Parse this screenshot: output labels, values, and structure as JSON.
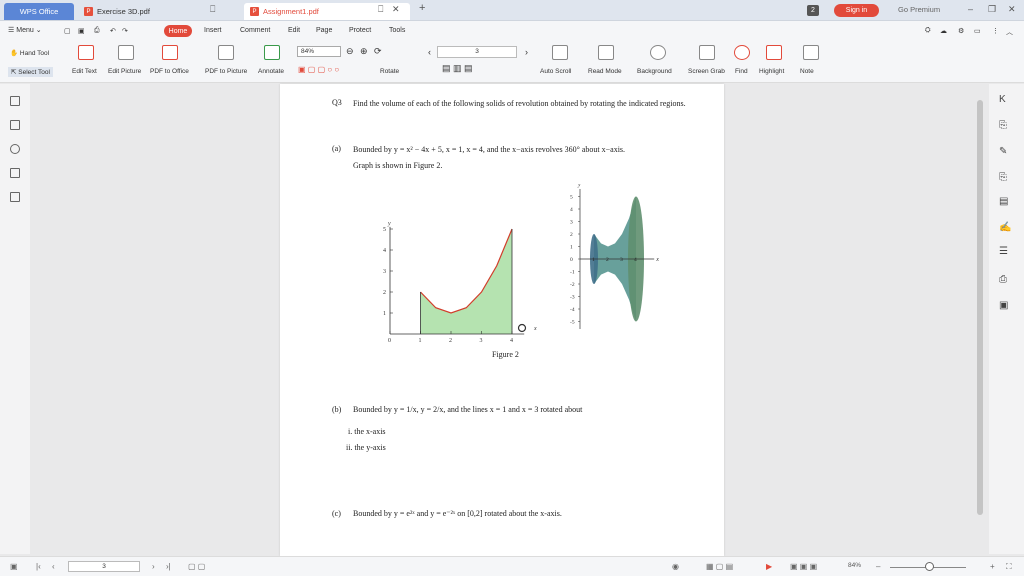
{
  "tabs": {
    "brand": "WPS Office",
    "doc1": "Exercise 3D.pdf",
    "doc2": "Assignment1.pdf",
    "new_tab": "+"
  },
  "header_right": {
    "badge": "2",
    "sign_in": "Sign in",
    "premium": "Go Premium"
  },
  "menu": {
    "menu_label": "Menu",
    "items": [
      "Home",
      "Insert",
      "Comment",
      "Edit",
      "Page",
      "Protect",
      "Tools"
    ]
  },
  "toolbar": {
    "hand_tool": "Hand Tool",
    "select_tool": "Select Tool",
    "edit_text": "Edit Text",
    "edit_picture": "Edit Picture",
    "pdf_to_office": "PDF to Office",
    "pdf_to_picture": "PDF to Picture",
    "annotate": "Annotate",
    "zoom_value": "84%",
    "rotate": "Rotate",
    "page_value": "3",
    "auto_scroll": "Auto Scroll",
    "read_mode": "Read Mode",
    "background": "Background",
    "screen_grab": "Screen Grab",
    "find": "Find",
    "highlight": "Highlight",
    "note": "Note"
  },
  "document": {
    "q_label": "Q3",
    "q_text": "Find the volume of each of the following solids of revolution obtained by rotating the indicated regions.",
    "a_label": "(a)",
    "a_text": "Bounded by y = x² − 4x + 5, x = 1, x = 4, and the x−axis revolves 360° about x−axis.",
    "a_text2": "Graph is shown in Figure 2.",
    "figure_caption": "Figure 2",
    "b_label": "(b)",
    "b_text": "Bounded by y = 1/x, y = 2/x, and the lines x = 1 and x = 3 rotated about",
    "b_i": "i.   the x-axis",
    "b_ii": "ii.   the y-axis",
    "c_label": "(c)",
    "c_text": "Bounded by y = e²ˣ and y = e⁻²ˣ on [0,2] rotated about the x-axis."
  },
  "chart_data": {
    "type": "area",
    "x": [
      1,
      1.5,
      2,
      2.5,
      3,
      3.5,
      4
    ],
    "values": [
      2,
      1.25,
      1,
      1.25,
      2,
      3.25,
      5
    ],
    "xlabel": "x",
    "ylabel": "y",
    "xlim": [
      0,
      4
    ],
    "ylim": [
      0,
      5
    ],
    "xticks": [
      "0",
      "1",
      "2",
      "3",
      "4"
    ],
    "yticks": [
      "0",
      "1",
      "2",
      "3",
      "4",
      "5"
    ],
    "solid_y_ticks": [
      "5",
      "4",
      "3",
      "2",
      "1",
      "0",
      "-1",
      "-2",
      "-3",
      "-4",
      "-5"
    ],
    "solid_x_ticks": [
      "1",
      "2",
      "3",
      "4"
    ],
    "fill_color": "#b5e3b0",
    "curve_color": "#d23c2a",
    "solid_color": "#4d8f8a"
  },
  "status": {
    "page_value": "3",
    "zoom_value": "84%"
  },
  "colors": {
    "accent": "#e24a3b",
    "brand": "#5b86d6"
  }
}
